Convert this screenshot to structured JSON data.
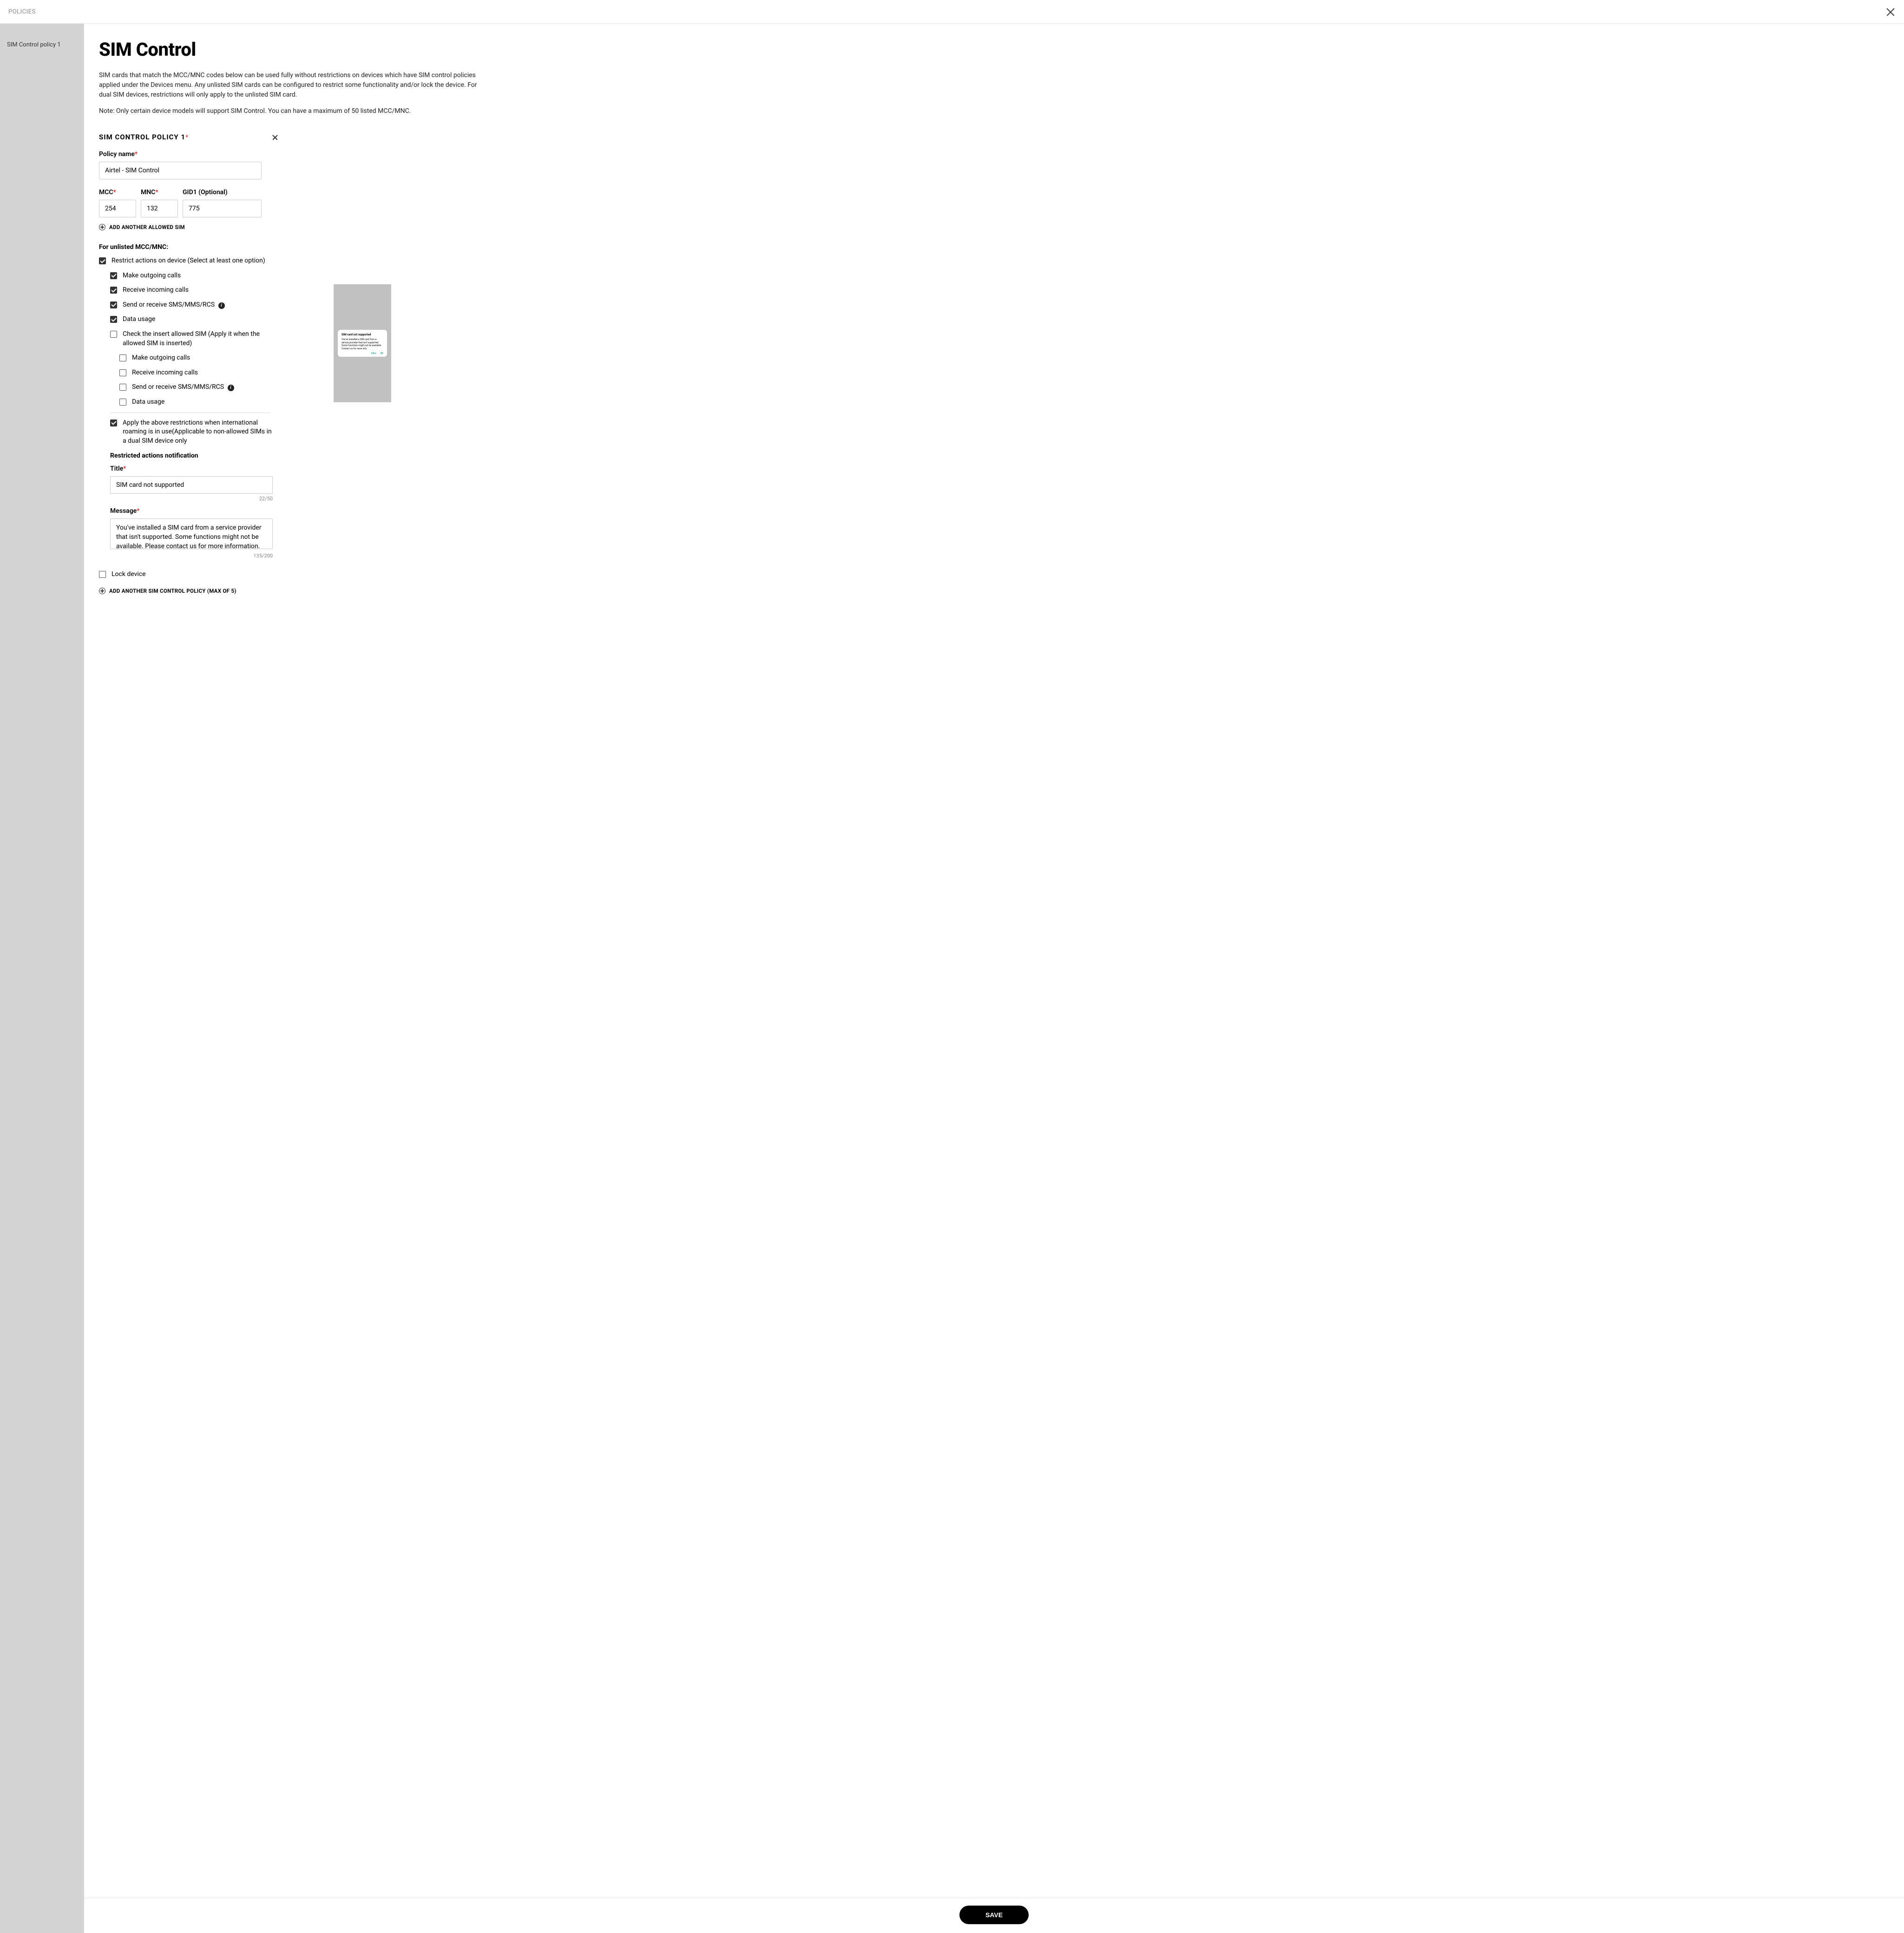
{
  "topbar": {
    "title": "POLICIES"
  },
  "sidebar": {
    "items": [
      {
        "label": "SIM Control policy 1"
      }
    ]
  },
  "page": {
    "heading": "SIM Control",
    "intro1": "SIM cards that match the MCC/MNC codes below can be used fully without restrictions on devices which have SIM control policies applied under the Devices menu. Any unlisted SIM cards can be configured to restrict some functionality and/or lock the device. For dual SIM devices, restrictions will only apply to the unlisted SIM card.",
    "intro2": "Note: Only certain device models will support SIM Control. You can have a maximum of 50 listed MCC/MNC."
  },
  "policy": {
    "section_title": "SIM CONTROL POLICY 1",
    "name_label": "Policy name",
    "name_value": "Airtel - SIM Control",
    "mcc_label": "MCC",
    "mcc_value": "254",
    "mnc_label": "MNC",
    "mnc_value": "132",
    "gid_label": "GID1 (Optional)",
    "gid_value": "775",
    "add_sim_label": "ADD ANOTHER ALLOWED SIM",
    "unlisted_header": "For unlisted MCC/MNC:",
    "restrict_label": "Restrict actions on device (Select at least one option)",
    "opt_outgoing": "Make outgoing calls",
    "opt_incoming": "Receive incoming calls",
    "opt_sms": "Send or receive SMS/MMS/RCS",
    "opt_data": "Data usage",
    "opt_check_insert": "Check the insert allowed SIM (Apply it when the allowed SIM is inserted)",
    "opt_roaming": "Apply the above restrictions when international roaming is in use(Applicable to non-allowed SIMs in a dual SIM device only",
    "notif_header": "Restricted actions notification",
    "notif_title_label": "Title",
    "notif_title_value": "SIM card not supported",
    "notif_title_counter": "22/50",
    "notif_msg_label": "Message",
    "notif_msg_value": "You've installed a SIM card from a service provider that isn't supported. Some functions might not be available. Please contact us for more information.",
    "notif_msg_counter": "135/200",
    "lock_device_label": "Lock device",
    "add_policy_label": "ADD ANOTHER SIM CONTROL POLICY  (MAX OF 5)"
  },
  "preview": {
    "title": "SIM card not supported",
    "message": "You've installed a SIM card from a service provider that isn't supported. Some functions might not be available. Contact us for more info.",
    "btn_call": "CALL",
    "btn_ok": "OK"
  },
  "footer": {
    "save": "SAVE"
  }
}
